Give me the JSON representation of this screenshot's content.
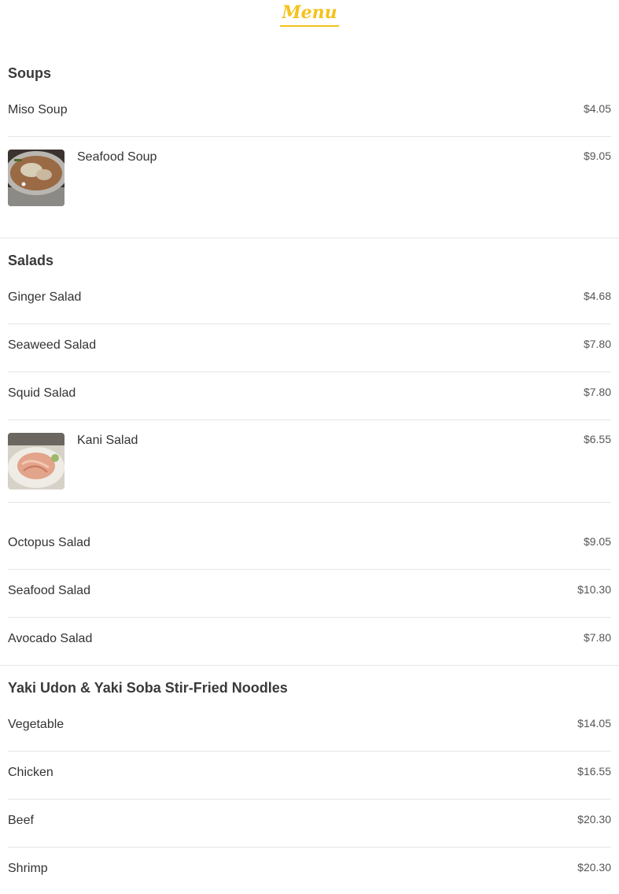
{
  "header": {
    "title": "Menu"
  },
  "sections": [
    {
      "title": "Soups",
      "items": [
        {
          "name": "Miso Soup",
          "price": "$4.05"
        },
        {
          "name": "Seafood Soup",
          "price": "$9.05",
          "photo": "soup-bowl"
        }
      ]
    },
    {
      "title": "Salads",
      "items": [
        {
          "name": "Ginger Salad",
          "price": "$4.68"
        },
        {
          "name": "Seaweed Salad",
          "price": "$7.80"
        },
        {
          "name": "Squid Salad",
          "price": "$7.80"
        },
        {
          "name": "Kani Salad",
          "price": "$6.55",
          "photo": "kani-salad-plate"
        },
        {
          "name": "Octopus Salad",
          "price": "$9.05"
        },
        {
          "name": "Seafood Salad",
          "price": "$10.30"
        },
        {
          "name": "Avocado Salad",
          "price": "$7.80"
        }
      ]
    },
    {
      "title": "Yaki Udon & Yaki Soba Stir-Fried Noodles",
      "items": [
        {
          "name": "Vegetable",
          "price": "$14.05"
        },
        {
          "name": "Chicken",
          "price": "$16.55"
        },
        {
          "name": "Beef",
          "price": "$20.30"
        },
        {
          "name": "Shrimp",
          "price": "$20.30"
        }
      ]
    }
  ],
  "colors": {
    "accent": "#f4c21a",
    "text": "#333333",
    "divider": "#e6e6e6"
  }
}
